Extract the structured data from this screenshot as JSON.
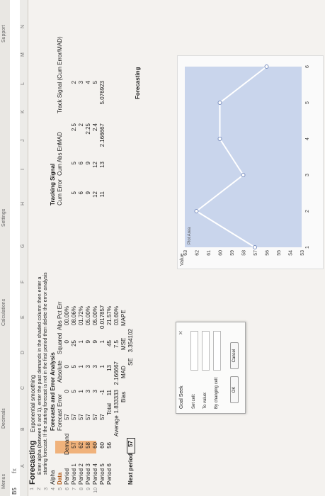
{
  "ribbon": {
    "tabs": [
      "Menus",
      "Decimals",
      "Calculations",
      "Settings",
      "Support"
    ],
    "name_box": "B5",
    "formula_glyph": "fx"
  },
  "title": "Forecasting",
  "subtitle": "Exponential smoothing",
  "instructions": [
    "Enter alpha (between 0 and 1), enter the past demands in the shaded column then enter a",
    "starting forecast. If the starting forecast is not in the first period then delete the error analysis"
  ],
  "labels": {
    "alpha": "Alpha",
    "data": "Data",
    "period": "Period",
    "demand": "Demand",
    "forecasts_header": "Forecasts and Error Analysis",
    "forecast": "Forecast",
    "error": "Error",
    "absolute": "Absolute",
    "squared": "Squared",
    "abs_pct_err": "Abs Pct Err",
    "tracking": "Tracking Signal",
    "cum_error": "Cum Error",
    "cum_abs": "Cum Abs Err",
    "mad_col": "MAD",
    "track_signal": "Track Signal (Cum Error/MAD)",
    "total": "Total",
    "average": "Average",
    "bias": "Bias",
    "mad": "MAD",
    "mse": "MSE",
    "mape": "MAPE",
    "se": "SE",
    "next_period": "Next period",
    "forecasting": "Forecasting"
  },
  "periods": [
    "Period 1",
    "Period 2",
    "Period 3",
    "Period 4",
    "Period 5",
    "Period 6"
  ],
  "demand": [
    "57",
    "62",
    "58",
    "60",
    "60",
    "56"
  ],
  "table_rows": [
    {
      "forecast": "57",
      "error": "0",
      "abs": "0",
      "sq": "0",
      "ape": "00.00%"
    },
    {
      "forecast": "57",
      "error": "5",
      "abs": "5",
      "sq": "25",
      "ape": "08.06%"
    },
    {
      "forecast": "57",
      "error": "1",
      "abs": "1",
      "sq": "1",
      "ape": "01.72%"
    },
    {
      "forecast": "57",
      "error": "3",
      "abs": "3",
      "sq": "9",
      "ape": "05.00%"
    },
    {
      "forecast": "57",
      "error": "3",
      "abs": "3",
      "sq": "9",
      "ape": "05.00%"
    },
    {
      "forecast": "57",
      "error": "-1",
      "abs": "1",
      "sq": "1",
      "ape": "0.017857"
    }
  ],
  "tracking_rows": [
    {
      "cum": "5",
      "cabs": "5",
      "mad": "2.5",
      "ts": "2"
    },
    {
      "cum": "6",
      "cabs": "6",
      "mad": "2",
      "ts": "3"
    },
    {
      "cum": "9",
      "cabs": "9",
      "mad": "2.25",
      "ts": "4"
    },
    {
      "cum": "12",
      "cabs": "12",
      "mad": "2.4",
      "ts": "5"
    },
    {
      "cum": "11",
      "cabs": "13",
      "mad": "2.166667",
      "ts": "5.076923"
    }
  ],
  "totals": {
    "error": "11",
    "abs": "13",
    "sq": "45",
    "ape": "21.57%"
  },
  "averages": {
    "value": "1.833333",
    "abs": "2.166667",
    "sq": "7.5",
    "ape": "03.60%"
  },
  "se_value": "3.354102",
  "next_period_value": "57",
  "goal_seek": {
    "title": "Goal Seek",
    "set_cell": "Set cell:",
    "to_value": "To value:",
    "by_changing": "By changing cell:",
    "ok": "OK",
    "cancel": "Cancel"
  },
  "chart_data": {
    "type": "line",
    "title": "",
    "ylabel": "Value",
    "x": [
      1,
      2,
      3,
      4,
      5,
      6
    ],
    "series": [
      {
        "values": [
          57,
          62,
          58,
          60,
          60,
          56
        ]
      }
    ],
    "ylim": [
      53,
      63
    ],
    "yticks": [
      53,
      54,
      55,
      56,
      57,
      58,
      59,
      60,
      61,
      62,
      63
    ],
    "xticks": [
      1,
      2,
      3,
      4,
      5,
      6
    ],
    "plot_area_label": "Plot Area",
    "colors": {
      "line": "#7a8fbf",
      "fill": "#c9d5ec"
    }
  }
}
